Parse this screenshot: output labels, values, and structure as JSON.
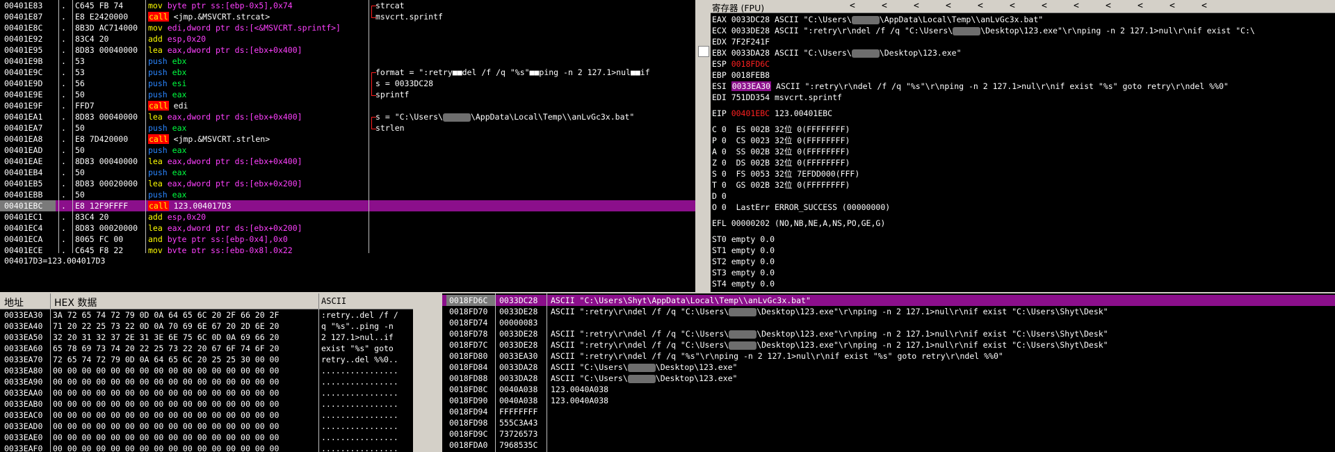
{
  "disasm": {
    "rows": [
      {
        "addr": "00401E83",
        "bytes": "C645 FB 74",
        "mn": "mov",
        "ops": "byte ptr ss:[ebp-0x5],0x74",
        "cmt": "strcat",
        "cmtc": "red"
      },
      {
        "addr": "00401E87",
        "bytes": "E8 E2420000",
        "mn": "call",
        "ops": "<jmp.&MSVCRT.strcat>",
        "cmt": "msvcrt.sprintf",
        "cmtc": "white"
      },
      {
        "addr": "00401E8C",
        "bytes": "8B3D AC714000",
        "mn": "mov",
        "ops": "edi,dword ptr ds:[<&MSVCRT.sprintf>]",
        "cmt": "",
        "cmtc": "white"
      },
      {
        "addr": "00401E92",
        "bytes": "83C4 20",
        "mn": "add",
        "ops": "esp,0x20",
        "cmt": "",
        "cmtc": "white"
      },
      {
        "addr": "00401E95",
        "bytes": "8D83 00040000",
        "mn": "lea",
        "ops": "eax,dword ptr ds:[ebx+0x400]",
        "cmt": "",
        "cmtc": "white"
      },
      {
        "addr": "00401E9B",
        "bytes": "53",
        "mn": "push",
        "ops": "ebx",
        "cmt": "",
        "cmtc": "white"
      },
      {
        "addr": "00401E9C",
        "bytes": "53",
        "mn": "push",
        "ops": "ebx",
        "cmt": "format = \":retry■■del /f /q \"%s\"■■ping -n 2 127.1>nul■■if",
        "cmtc": "white"
      },
      {
        "addr": "00401E9D",
        "bytes": "56",
        "mn": "push",
        "ops": "esi",
        "cmt": "s = 0033DC28",
        "cmtc": "white"
      },
      {
        "addr": "00401E9E",
        "bytes": "50",
        "mn": "push",
        "ops": "eax",
        "cmt": "sprintf",
        "cmtc": "red"
      },
      {
        "addr": "00401E9F",
        "bytes": "FFD7",
        "mn": "call",
        "ops": "edi",
        "cmt": "",
        "cmtc": "white"
      },
      {
        "addr": "00401EA1",
        "bytes": "8D83 00040000",
        "mn": "lea",
        "ops": "eax,dword ptr ds:[ebx+0x400]",
        "cmt": "s = \"C:\\Users\\",
        "cmtb": "\\AppData\\Local\\Temp\\\\anLvGc3x.bat\"",
        "cmtc": "white"
      },
      {
        "addr": "00401EA7",
        "bytes": "50",
        "mn": "push",
        "ops": "eax",
        "cmt": "strlen",
        "cmtc": "red"
      },
      {
        "addr": "00401EA8",
        "bytes": "E8 7D420000",
        "mn": "call",
        "ops": "<jmp.&MSVCRT.strlen>",
        "cmt": "",
        "cmtc": "white"
      },
      {
        "addr": "00401EAD",
        "bytes": "50",
        "mn": "push",
        "ops": "eax",
        "cmt": "",
        "cmtc": "white"
      },
      {
        "addr": "00401EAE",
        "bytes": "8D83 00040000",
        "mn": "lea",
        "ops": "eax,dword ptr ds:[ebx+0x400]",
        "cmt": "",
        "cmtc": "white"
      },
      {
        "addr": "00401EB4",
        "bytes": "50",
        "mn": "push",
        "ops": "eax",
        "cmt": "",
        "cmtc": "white"
      },
      {
        "addr": "00401EB5",
        "bytes": "8D83 00020000",
        "mn": "lea",
        "ops": "eax,dword ptr ds:[ebx+0x200]",
        "cmt": "",
        "cmtc": "white"
      },
      {
        "addr": "00401EBB",
        "bytes": "50",
        "mn": "push",
        "ops": "eax",
        "cmt": "",
        "cmtc": "white"
      },
      {
        "addr": "00401EBC",
        "bytes": "E8 12F9FFFF",
        "mn": "call",
        "ops": "123.004017D3",
        "cmt": "",
        "cmtc": "white",
        "sel": true
      },
      {
        "addr": "00401EC1",
        "bytes": "83C4 20",
        "mn": "add",
        "ops": "esp,0x20",
        "cmt": "",
        "cmtc": "white"
      },
      {
        "addr": "00401EC4",
        "bytes": "8D83 00020000",
        "mn": "lea",
        "ops": "eax,dword ptr ds:[ebx+0x200]",
        "cmt": "",
        "cmtc": "white"
      },
      {
        "addr": "00401ECA",
        "bytes": "8065 FC 00",
        "mn": "and",
        "ops": "byte ptr ss:[ebp-0x4],0x0",
        "cmt": "",
        "cmtc": "white"
      },
      {
        "addr": "00401ECE",
        "bytes": "C645 F8 22",
        "mn": "mov",
        "ops": "byte ptr ss:[ebp-0x8],0x22",
        "cmt": "",
        "cmtc": "white"
      }
    ]
  },
  "infobar": {
    "text": "004017D3=123.004017D3"
  },
  "registers": {
    "title": "寄存器 (FPU)",
    "arrow": "<",
    "lines": [
      {
        "pre": "EAX 0033DC28 ASCII \"C:\\Users\\",
        "blur": true,
        "post": "\\AppData\\Local\\Temp\\\\anLvGc3x.bat\""
      },
      {
        "pre": "ECX 0033DE28 ASCII \":retry\\r\\ndel /f /q \"C:\\Users\\",
        "blur": true,
        "post": "\\Desktop\\123.exe\"\\r\\nping -n 2 127.1>nul\\r\\nif exist \"C:\\"
      },
      {
        "pre": "EDX 7F2F241F"
      },
      {
        "pre": "EBX 0033DA28 ASCII \"C:\\Users\\",
        "blur": true,
        "post": "\\Desktop\\123.exe\""
      },
      {
        "pre": "ESP ",
        "red": "0018FD6C"
      },
      {
        "pre": "EBP 0018FEB8"
      },
      {
        "pre": "ESI ",
        "hl": "0033EA30",
        "post": " ASCII \":retry\\r\\ndel /f /q \"%s\"\\r\\nping -n 2 127.1>nul\\r\\nif exist \"%s\" goto retry\\r\\ndel %%0\""
      },
      {
        "pre": "EDI 751DD354 msvcrt.sprintf"
      },
      {
        "pre": ""
      },
      {
        "pre": "EIP ",
        "red": "00401EBC",
        "post": " 123.00401EBC"
      },
      {
        "pre": ""
      },
      {
        "pre": "C 0  ES 002B 32位 0(FFFFFFFF)"
      },
      {
        "pre": "P 0  CS 0023 32位 0(FFFFFFFF)"
      },
      {
        "pre": "A 0  SS 002B 32位 0(FFFFFFFF)"
      },
      {
        "pre": "Z 0  DS 002B 32位 0(FFFFFFFF)"
      },
      {
        "pre": "S 0  FS 0053 32位 7EFDD000(FFF)"
      },
      {
        "pre": "T 0  GS 002B 32位 0(FFFFFFFF)"
      },
      {
        "pre": "D 0"
      },
      {
        "pre": "O 0  LastErr ERROR_SUCCESS (00000000)"
      },
      {
        "pre": ""
      },
      {
        "pre": "EFL 00000202 (NO,NB,NE,A,NS,PO,GE,G)"
      },
      {
        "pre": ""
      },
      {
        "pre": "ST0 empty 0.0"
      },
      {
        "pre": "ST1 empty 0.0"
      },
      {
        "pre": "ST2 empty 0.0"
      },
      {
        "pre": "ST3 empty 0.0"
      },
      {
        "pre": "ST4 empty 0.0"
      }
    ]
  },
  "hexdump": {
    "col_addr": "地址",
    "col_hex": "HEX 数据",
    "col_ascii": "ASCII",
    "rows": [
      {
        "addr": "0033EA30",
        "hex": "3A 72 65 74 72 79 0D 0A 64 65 6C 20 2F 66 20 2F",
        "asc": ":retry..del /f /"
      },
      {
        "addr": "0033EA40",
        "hex": "71 20 22 25 73 22 0D 0A 70 69 6E 67 20 2D 6E 20",
        "asc": "q \"%s\"..ping -n"
      },
      {
        "addr": "0033EA50",
        "hex": "32 20 31 32 37 2E 31 3E 6E 75 6C 0D 0A 69 66 20",
        "asc": "2 127.1>nul..if"
      },
      {
        "addr": "0033EA60",
        "hex": "65 78 69 73 74 20 22 25 73 22 20 67 6F 74 6F 20",
        "asc": "exist \"%s\" goto"
      },
      {
        "addr": "0033EA70",
        "hex": "72 65 74 72 79 0D 0A 64 65 6C 20 25 25 30 00 00",
        "asc": "retry..del %%0.."
      },
      {
        "addr": "0033EA80",
        "hex": "00 00 00 00 00 00 00 00 00 00 00 00 00 00 00 00",
        "asc": "................"
      },
      {
        "addr": "0033EA90",
        "hex": "00 00 00 00 00 00 00 00 00 00 00 00 00 00 00 00",
        "asc": "................"
      },
      {
        "addr": "0033EAA0",
        "hex": "00 00 00 00 00 00 00 00 00 00 00 00 00 00 00 00",
        "asc": "................"
      },
      {
        "addr": "0033EAB0",
        "hex": "00 00 00 00 00 00 00 00 00 00 00 00 00 00 00 00",
        "asc": "................"
      },
      {
        "addr": "0033EAC0",
        "hex": "00 00 00 00 00 00 00 00 00 00 00 00 00 00 00 00",
        "asc": "................"
      },
      {
        "addr": "0033EAD0",
        "hex": "00 00 00 00 00 00 00 00 00 00 00 00 00 00 00 00",
        "asc": "................"
      },
      {
        "addr": "0033EAE0",
        "hex": "00 00 00 00 00 00 00 00 00 00 00 00 00 00 00 00",
        "asc": "................"
      },
      {
        "addr": "0033EAF0",
        "hex": "00 00 00 00 00 00 00 00 00 00 00 00 00 00 00 00",
        "asc": "................"
      }
    ]
  },
  "stack": {
    "rows": [
      {
        "addr": "0018FD6C",
        "val": "0033DC28",
        "pre": "ASCII \"C:\\Users\\Shyt\\AppData\\Local\\Temp\\\\anLvGc3x.bat\"",
        "sel": true
      },
      {
        "addr": "0018FD70",
        "val": "0033DE28",
        "pre": "ASCII \":retry\\r\\ndel /f /q \"C:\\Users\\",
        "blur": true,
        "post": "\\Desktop\\123.exe\"\\r\\nping -n 2 127.1>nul\\r\\nif exist \"C:\\Users\\Shyt\\Desk\""
      },
      {
        "addr": "0018FD74",
        "val": "00000083",
        "pre": ""
      },
      {
        "addr": "0018FD78",
        "val": "0033DE28",
        "pre": "ASCII \":retry\\r\\ndel /f /q \"C:\\Users\\",
        "blur": true,
        "post": "\\Desktop\\123.exe\"\\r\\nping -n 2 127.1>nul\\r\\nif exist \"C:\\Users\\Shyt\\Desk\""
      },
      {
        "addr": "0018FD7C",
        "val": "0033DE28",
        "pre": "ASCII \":retry\\r\\ndel /f /q \"C:\\Users\\",
        "blur": true,
        "post": "\\Desktop\\123.exe\"\\r\\nping -n 2 127.1>nul\\r\\nif exist \"C:\\Users\\Shyt\\Desk\""
      },
      {
        "addr": "0018FD80",
        "val": "0033EA30",
        "pre": "ASCII \":retry\\r\\ndel /f /q \"%s\"\\r\\nping -n 2 127.1>nul\\r\\nif exist \"%s\" goto retry\\r\\ndel %%0\""
      },
      {
        "addr": "0018FD84",
        "val": "0033DA28",
        "pre": "ASCII \"C:\\Users\\",
        "blur": true,
        "post": "\\Desktop\\123.exe\""
      },
      {
        "addr": "0018FD88",
        "val": "0033DA28",
        "pre": "ASCII \"C:\\Users\\",
        "blur": true,
        "post": "\\Desktop\\123.exe\""
      },
      {
        "addr": "0018FD8C",
        "val": "0040A038",
        "pre": "123.0040A038"
      },
      {
        "addr": "0018FD90",
        "val": "0040A038",
        "pre": "123.0040A038"
      },
      {
        "addr": "0018FD94",
        "val": "FFFFFFFF",
        "pre": ""
      },
      {
        "addr": "0018FD98",
        "val": "555C3A43",
        "pre": ""
      },
      {
        "addr": "0018FD9C",
        "val": "73726573",
        "pre": ""
      },
      {
        "addr": "0018FDA0",
        "val": "7968535C",
        "pre": ""
      }
    ]
  }
}
